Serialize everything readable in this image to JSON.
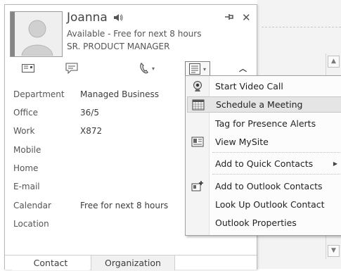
{
  "contact": {
    "name": "Joanna",
    "status": "Available - Free for next 8 hours",
    "title": "SR. PRODUCT MANAGER"
  },
  "fields": [
    {
      "label": "Department",
      "value": "Managed Business"
    },
    {
      "label": "Office",
      "value": "36/5"
    },
    {
      "label": "Work",
      "value": "X872"
    },
    {
      "label": "Mobile",
      "value": ""
    },
    {
      "label": "Home",
      "value": ""
    },
    {
      "label": "E-mail",
      "value": ""
    },
    {
      "label": "Calendar",
      "value": "Free for next 8 hours"
    },
    {
      "label": "Location",
      "value": ""
    }
  ],
  "tabs": {
    "contact": "Contact",
    "organization": "Organization"
  },
  "menu": {
    "items": [
      {
        "label": "Start Video Call"
      },
      {
        "label": "Schedule a Meeting"
      },
      {
        "label": "Tag for Presence Alerts"
      },
      {
        "label": "View MySite"
      },
      {
        "label": "Add to Quick Contacts"
      },
      {
        "label": "Add to Outlook Contacts"
      },
      {
        "label": "Look Up Outlook Contact"
      },
      {
        "label": "Outlook Properties"
      }
    ]
  },
  "colors": {
    "presence": "#858585",
    "highlight": "#e5e5e5"
  }
}
